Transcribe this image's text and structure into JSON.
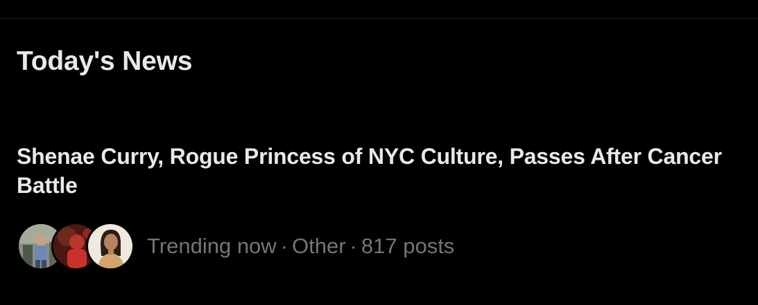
{
  "section": {
    "title": "Today's News"
  },
  "story": {
    "headline": "Shenae Curry, Rogue Princess of NYC Culture, Passes After Cancer Battle",
    "meta": {
      "status": "Trending now",
      "separator": "·",
      "category": "Other",
      "post_count": "817 posts"
    },
    "avatars": [
      "avatar-1",
      "avatar-2",
      "avatar-3"
    ]
  },
  "colors": {
    "background": "#000000",
    "primary_text": "#e7e9ea",
    "secondary_text": "#71767b"
  }
}
